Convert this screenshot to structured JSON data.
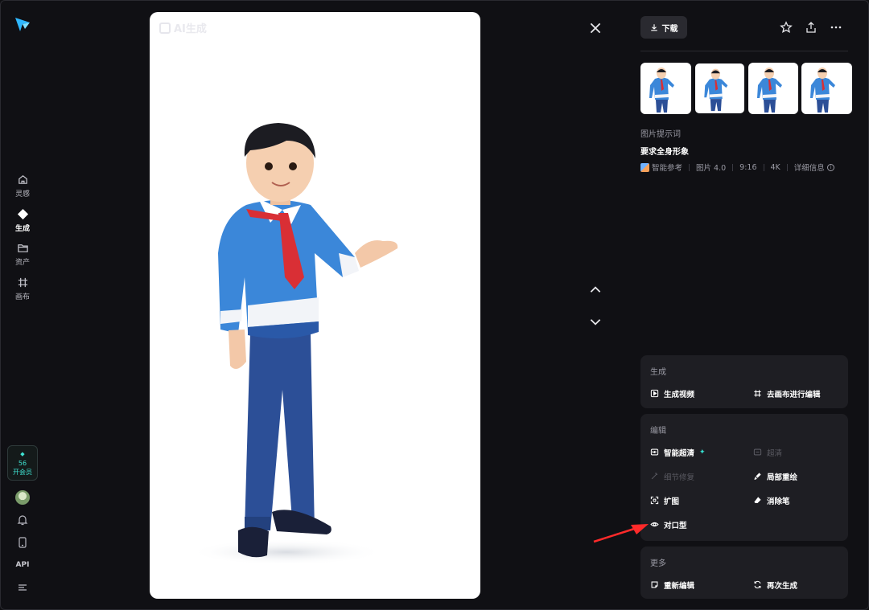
{
  "sidebar": {
    "nav": [
      {
        "id": "inspiration",
        "label": "灵感",
        "icon": "home-icon"
      },
      {
        "id": "generate",
        "label": "生成",
        "icon": "diamond-icon",
        "active": true
      },
      {
        "id": "assets",
        "label": "资产",
        "icon": "folder-icon"
      },
      {
        "id": "canvas",
        "label": "画布",
        "icon": "grid-icon"
      }
    ],
    "vip": {
      "coins": "56",
      "label": "开会员"
    },
    "api_label": "API"
  },
  "canvas": {
    "watermark": "AI生成"
  },
  "panel": {
    "download_label": "下载",
    "prompt_label": "图片提示词",
    "prompt_text": "要求全身形象",
    "meta": {
      "reference": "智能参考",
      "model": "图片 4.0",
      "ratio": "9:16",
      "resolution": "4K",
      "details": "详细信息"
    },
    "sections": {
      "generate": {
        "title": "生成",
        "actions": [
          "生成视频",
          "去画布进行编辑"
        ]
      },
      "edit": {
        "title": "编辑",
        "actions": [
          "智能超清",
          "超清",
          "细节修复",
          "局部重绘",
          "扩图",
          "消除笔",
          "对口型"
        ]
      },
      "more": {
        "title": "更多",
        "actions": [
          "重新编辑",
          "再次生成"
        ]
      }
    }
  },
  "colors": {
    "background": "#101014",
    "card": "#1e1e23",
    "accent": "#35e0d0",
    "annotation_arrow": "#ff2a2a"
  }
}
